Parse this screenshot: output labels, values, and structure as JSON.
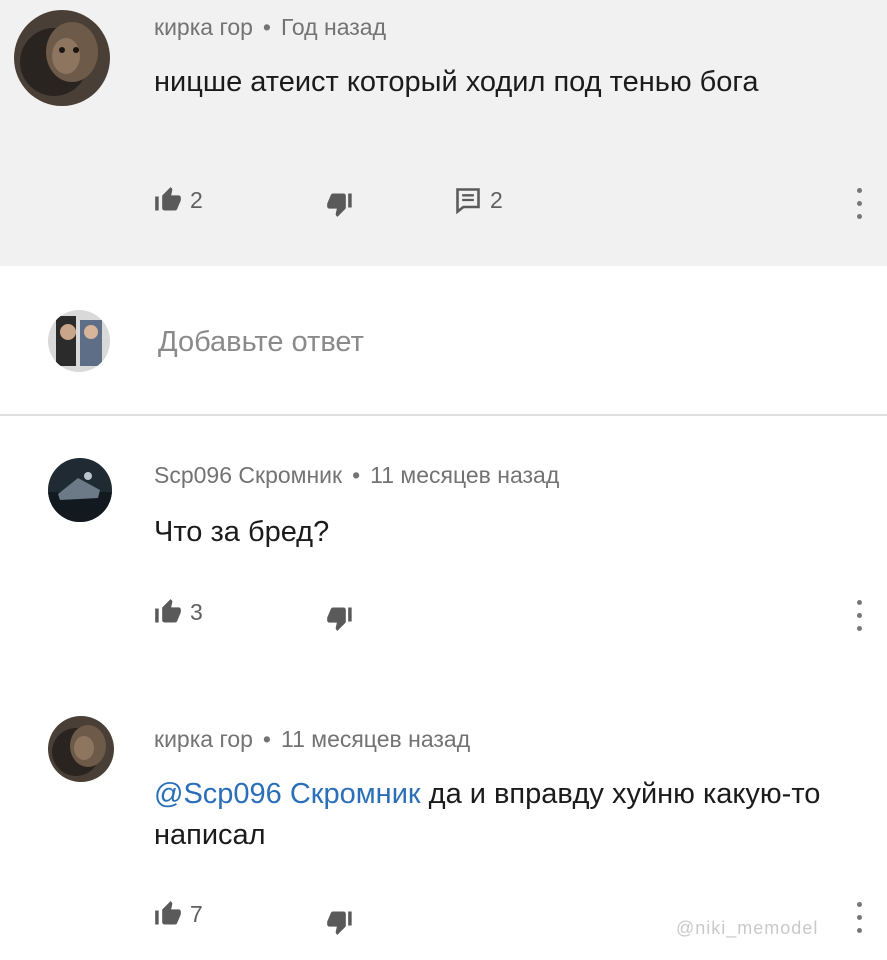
{
  "comment1": {
    "author": "кирка гор",
    "time": "Год назад",
    "text": "ницше атеист который ходил под тенью бога",
    "likes": "2",
    "replies": "2"
  },
  "reply_box": {
    "placeholder": "Добавьте ответ"
  },
  "comment2": {
    "author": "Scp096 Скромник",
    "time": "11 месяцев назад",
    "text": "Что за бред?",
    "likes": "3"
  },
  "comment3": {
    "author": "кирка гор",
    "time": "11 месяцев назад",
    "mention": "@Scp096 Скромник",
    "text": " да и вправду хуйню какую-то написал",
    "likes": "7"
  },
  "separator": "•",
  "watermark": "@niki_memodel",
  "icons": [
    "like-icon",
    "dislike-icon",
    "reply-icon",
    "more-vertical-icon"
  ]
}
